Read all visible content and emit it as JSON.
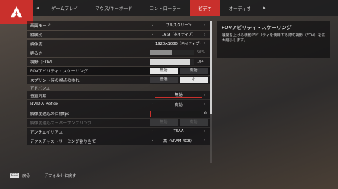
{
  "brand_color": "#c9302c",
  "header": {
    "tabs": [
      {
        "label": "ゲームプレイ"
      },
      {
        "label": "マウス/キーボード"
      },
      {
        "label": "コントローラー"
      },
      {
        "label": "ビデオ"
      },
      {
        "label": "オーディオ"
      }
    ],
    "active_tab": "ビデオ"
  },
  "settings": {
    "display_mode": {
      "label": "画面モード",
      "value": "フルスクリーン"
    },
    "aspect_ratio": {
      "label": "縦横比",
      "value": "16:9（ネイティブ）"
    },
    "resolution": {
      "label": "解像度",
      "value": "1920×1080（ネイティブ）"
    },
    "brightness": {
      "label": "明るさ",
      "value": "50%",
      "fraction": 0.5
    },
    "fov": {
      "label": "視野（FOV）",
      "value": "104",
      "fraction": 0.9
    },
    "fov_scaling": {
      "label": "FOVアビリティ・スケーリング",
      "off": "無効",
      "on": "有効",
      "selected": "無効"
    },
    "sprint_shake": {
      "label": "スプリント時の視点のゆれ",
      "normal": "普通",
      "small": "小",
      "selected": "小"
    },
    "advanced_label": "アドバンス",
    "vsync": {
      "label": "垂直同期",
      "value": "無効"
    },
    "reflex": {
      "label": "NVIDIA Reflex",
      "value": "有効"
    },
    "adaptive_target": {
      "label": "解像度適応の目標fps",
      "value": "0"
    },
    "adaptive_supersampling": {
      "label": "解像度適応スーパーサンプリング",
      "off": "無効",
      "on": "有効"
    },
    "antialiasing": {
      "label": "アンチエイリアス",
      "value": "TSAA"
    },
    "texture_budget": {
      "label": "テクスチャストリーミング割り当て",
      "value": "高（VRAM 4GB）"
    }
  },
  "description": {
    "title": "FOVアビリティ・スケーリング",
    "body": "速度を上げる移動アビリティを使用する際の視野（FOV）を拡大縮小します。"
  },
  "footer": {
    "esc_key": "ESC",
    "back_label": "戻る",
    "default_label": "デフォルトに戻す"
  }
}
